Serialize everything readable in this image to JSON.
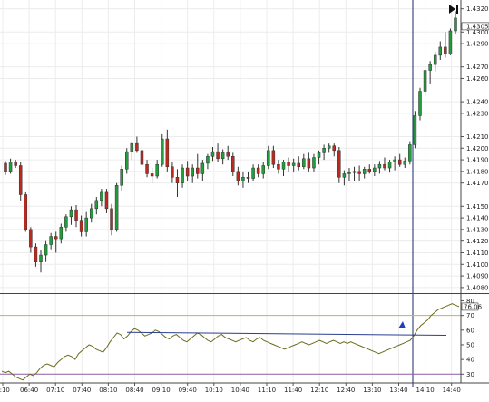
{
  "chart_data": {
    "type": "candlestick",
    "price_axis": {
      "ylim": [
        1.4076,
        1.4326
      ],
      "tick_labels": [
        "1.4320",
        "1.4300",
        "1.4290",
        "1.4270",
        "1.4260",
        "1.4240",
        "1.4230",
        "1.4210",
        "1.4200",
        "1.4190",
        "1.4180",
        "1.4170",
        "1.4150",
        "1.4140",
        "1.4130",
        "1.4120",
        "1.4110",
        "1.4100",
        "1.4090",
        "1.4080"
      ],
      "tick_values": [
        1.432,
        1.43,
        1.429,
        1.427,
        1.426,
        1.424,
        1.423,
        1.421,
        1.42,
        1.419,
        1.418,
        1.417,
        1.415,
        1.414,
        1.413,
        1.412,
        1.411,
        1.41,
        1.409,
        1.408
      ],
      "last_price_label": "1.4305"
    },
    "time_axis": {
      "tick_labels": [
        "6:10",
        "06:40",
        "07:10",
        "07:40",
        "08:10",
        "08:40",
        "09:10",
        "09:40",
        "10:10",
        "10:40",
        "11:10",
        "11:40",
        "12:10",
        "12:40",
        "13:10",
        "13:40",
        "14:10",
        "14:40"
      ]
    },
    "candles": [
      [
        1.4187,
        1.4189,
        1.4177,
        1.418
      ],
      [
        1.418,
        1.4191,
        1.4178,
        1.4188
      ],
      [
        1.4188,
        1.419,
        1.4183,
        1.4185
      ],
      [
        1.4185,
        1.4188,
        1.4155,
        1.416
      ],
      [
        1.416,
        1.4162,
        1.4128,
        1.413
      ],
      [
        1.413,
        1.4132,
        1.411,
        1.4115
      ],
      [
        1.4115,
        1.4118,
        1.4098,
        1.4102
      ],
      [
        1.4102,
        1.4112,
        1.4093,
        1.4108
      ],
      [
        1.4108,
        1.412,
        1.4102,
        1.4117
      ],
      [
        1.4117,
        1.4127,
        1.4113,
        1.4124
      ],
      [
        1.4124,
        1.4128,
        1.411,
        1.4122
      ],
      [
        1.4122,
        1.4135,
        1.4118,
        1.4132
      ],
      [
        1.4132,
        1.4143,
        1.4128,
        1.4141
      ],
      [
        1.4141,
        1.415,
        1.4134,
        1.4147
      ],
      [
        1.4147,
        1.4151,
        1.4132,
        1.4138
      ],
      [
        1.4138,
        1.4142,
        1.4124,
        1.4128
      ],
      [
        1.4128,
        1.4145,
        1.4124,
        1.414
      ],
      [
        1.414,
        1.4152,
        1.4136,
        1.4148
      ],
      [
        1.4148,
        1.4158,
        1.4143,
        1.4155
      ],
      [
        1.4155,
        1.4165,
        1.415,
        1.4162
      ],
      [
        1.4162,
        1.4165,
        1.4144,
        1.4148
      ],
      [
        1.4148,
        1.4152,
        1.4125,
        1.413
      ],
      [
        1.413,
        1.417,
        1.4128,
        1.4168
      ],
      [
        1.4168,
        1.4185,
        1.4163,
        1.4182
      ],
      [
        1.4182,
        1.42,
        1.4178,
        1.4197
      ],
      [
        1.4197,
        1.4206,
        1.419,
        1.4204
      ],
      [
        1.4204,
        1.421,
        1.4196,
        1.4198
      ],
      [
        1.4198,
        1.4202,
        1.4183,
        1.4186
      ],
      [
        1.4186,
        1.419,
        1.4175,
        1.4178
      ],
      [
        1.4178,
        1.4183,
        1.417,
        1.4176
      ],
      [
        1.4176,
        1.419,
        1.4174,
        1.4186
      ],
      [
        1.4186,
        1.4212,
        1.4184,
        1.4208
      ],
      [
        1.4208,
        1.4216,
        1.418,
        1.4184
      ],
      [
        1.4184,
        1.4188,
        1.417,
        1.4175
      ],
      [
        1.4175,
        1.4182,
        1.4158,
        1.417
      ],
      [
        1.417,
        1.4186,
        1.4166,
        1.4183
      ],
      [
        1.4183,
        1.4189,
        1.4172,
        1.4176
      ],
      [
        1.4176,
        1.4186,
        1.417,
        1.4183
      ],
      [
        1.4183,
        1.4195,
        1.4174,
        1.4178
      ],
      [
        1.4178,
        1.419,
        1.4172,
        1.4187
      ],
      [
        1.4187,
        1.4195,
        1.4182,
        1.4193
      ],
      [
        1.4193,
        1.4201,
        1.4189,
        1.4197
      ],
      [
        1.4197,
        1.4204,
        1.4188,
        1.4191
      ],
      [
        1.4191,
        1.4199,
        1.4186,
        1.4196
      ],
      [
        1.4196,
        1.4202,
        1.419,
        1.4193
      ],
      [
        1.4193,
        1.4196,
        1.4176,
        1.418
      ],
      [
        1.418,
        1.4184,
        1.4168,
        1.4172
      ],
      [
        1.4172,
        1.418,
        1.4166,
        1.4175
      ],
      [
        1.4175,
        1.418,
        1.417,
        1.4174
      ],
      [
        1.4174,
        1.4186,
        1.4172,
        1.4183
      ],
      [
        1.4183,
        1.4186,
        1.4175,
        1.4178
      ],
      [
        1.4178,
        1.4188,
        1.4174,
        1.4185
      ],
      [
        1.4185,
        1.4202,
        1.4182,
        1.4198
      ],
      [
        1.4198,
        1.4202,
        1.4183,
        1.4186
      ],
      [
        1.4186,
        1.419,
        1.4178,
        1.4182
      ],
      [
        1.4182,
        1.419,
        1.4176,
        1.4188
      ],
      [
        1.4188,
        1.4192,
        1.418,
        1.4185
      ],
      [
        1.4185,
        1.4191,
        1.418,
        1.4187
      ],
      [
        1.4187,
        1.4193,
        1.4181,
        1.4184
      ],
      [
        1.4184,
        1.4195,
        1.4182,
        1.4191
      ],
      [
        1.4191,
        1.4196,
        1.418,
        1.4183
      ],
      [
        1.4183,
        1.4195,
        1.418,
        1.4192
      ],
      [
        1.4192,
        1.4198,
        1.4186,
        1.4196
      ],
      [
        1.4196,
        1.4203,
        1.419,
        1.42
      ],
      [
        1.42,
        1.4204,
        1.4196,
        1.4202
      ],
      [
        1.4202,
        1.4204,
        1.4193,
        1.4198
      ],
      [
        1.4198,
        1.4201,
        1.417,
        1.4175
      ],
      [
        1.4175,
        1.4181,
        1.4168,
        1.4178
      ],
      [
        1.4178,
        1.4183,
        1.4172,
        1.4179
      ],
      [
        1.4179,
        1.4184,
        1.4172,
        1.418
      ],
      [
        1.418,
        1.4185,
        1.4172,
        1.4178
      ],
      [
        1.4178,
        1.4184,
        1.4174,
        1.4182
      ],
      [
        1.4182,
        1.4186,
        1.4178,
        1.418
      ],
      [
        1.418,
        1.4186,
        1.4176,
        1.4183
      ],
      [
        1.4183,
        1.4189,
        1.4178,
        1.4186
      ],
      [
        1.4186,
        1.4192,
        1.4181,
        1.4183
      ],
      [
        1.4183,
        1.419,
        1.4179,
        1.4188
      ],
      [
        1.4188,
        1.4193,
        1.4181,
        1.419
      ],
      [
        1.419,
        1.4195,
        1.4184,
        1.4186
      ],
      [
        1.4186,
        1.4192,
        1.4183,
        1.4189
      ],
      [
        1.4189,
        1.4206,
        1.4186,
        1.4203
      ],
      [
        1.4203,
        1.4232,
        1.42,
        1.4228
      ],
      [
        1.4228,
        1.4252,
        1.4224,
        1.4249
      ],
      [
        1.4249,
        1.427,
        1.4245,
        1.4267
      ],
      [
        1.4267,
        1.4275,
        1.4255,
        1.4272
      ],
      [
        1.4272,
        1.4283,
        1.4266,
        1.428
      ],
      [
        1.428,
        1.4292,
        1.4276,
        1.4287
      ],
      [
        1.4287,
        1.43,
        1.4278,
        1.4281
      ],
      [
        1.4281,
        1.4303,
        1.428,
        1.4301
      ],
      [
        1.4301,
        1.4318,
        1.4298,
        1.4312
      ]
    ],
    "oscillator": {
      "tick_labels": [
        "80",
        "70",
        "60",
        "50",
        "40",
        "30"
      ],
      "tick_values": [
        80,
        70,
        60,
        50,
        40,
        30
      ],
      "ylim": [
        24,
        84
      ],
      "levels": [
        70,
        30
      ],
      "last_value_label": "76.06",
      "values": [
        32,
        31,
        32,
        30,
        28,
        27,
        26,
        28,
        30,
        29,
        31,
        34,
        36,
        37,
        36,
        35,
        38,
        40,
        42,
        43,
        42,
        40,
        44,
        46,
        48,
        50,
        49,
        47,
        46,
        45,
        48,
        52,
        55,
        58,
        57,
        54,
        56,
        59,
        61,
        60,
        58,
        56,
        57,
        58,
        60,
        59,
        57,
        55,
        54,
        56,
        57,
        55,
        53,
        52,
        54,
        56,
        58,
        57,
        55,
        53,
        52,
        54,
        56,
        57,
        55,
        54,
        53,
        52,
        53,
        54,
        55,
        53,
        52,
        54,
        55,
        53,
        52,
        51,
        50,
        49,
        48,
        47,
        48,
        49,
        50,
        51,
        52,
        51,
        50,
        51,
        52,
        53,
        52,
        51,
        52,
        53,
        52,
        51,
        52,
        51,
        52,
        51,
        50,
        49,
        48,
        47,
        46,
        45,
        44,
        45,
        46,
        47,
        48,
        49,
        50,
        51,
        52,
        53,
        56,
        60,
        63,
        65,
        67,
        70,
        72,
        74,
        75,
        76,
        77,
        78,
        77,
        76
      ]
    },
    "annotations": {
      "trendline_price": [
        1.4143,
        1.4186
      ],
      "trendline_osc": [
        58.5,
        56.5
      ]
    }
  }
}
